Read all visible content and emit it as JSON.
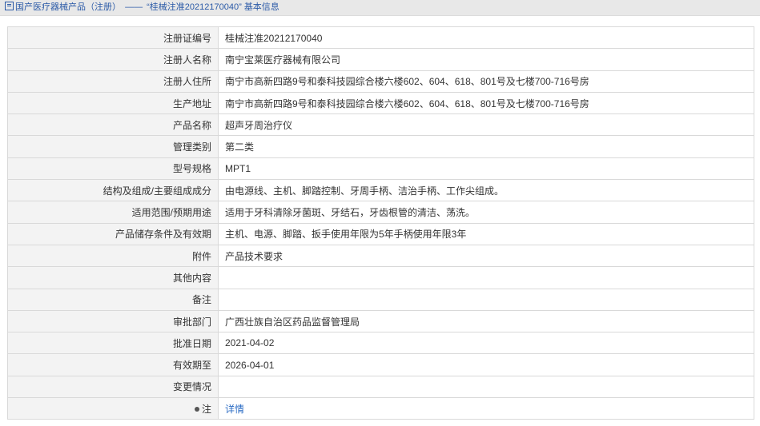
{
  "breadcrumb": {
    "part1": "国产医疗器械产品（注册）",
    "separator": "——",
    "part2": "“桂械注准20212170040”",
    "part3": "基本信息"
  },
  "rows": [
    {
      "label": "注册证编号",
      "value": "桂械注准20212170040"
    },
    {
      "label": "注册人名称",
      "value": "南宁宝莱医疗器械有限公司"
    },
    {
      "label": "注册人住所",
      "value": "南宁市高新四路9号和泰科技园综合楼六楼602、604、618、801号及七楼700-716号房"
    },
    {
      "label": "生产地址",
      "value": "南宁市高新四路9号和泰科技园综合楼六楼602、604、618、801号及七楼700-716号房"
    },
    {
      "label": "产品名称",
      "value": "超声牙周治疗仪"
    },
    {
      "label": "管理类别",
      "value": "第二类"
    },
    {
      "label": "型号规格",
      "value": "MPT1"
    },
    {
      "label": "结构及组成/主要组成成分",
      "value": "由电源线、主机、脚踏控制、牙周手柄、洁治手柄、工作尖组成。"
    },
    {
      "label": "适用范围/预期用途",
      "value": "适用于牙科清除牙菌斑、牙结石，牙齿根管的清洁、荡洗。"
    },
    {
      "label": "产品储存条件及有效期",
      "value": "主机、电源、脚踏、扳手使用年限为5年手柄使用年限3年"
    },
    {
      "label": "附件",
      "value": "产品技术要求"
    },
    {
      "label": "其他内容",
      "value": ""
    },
    {
      "label": "备注",
      "value": ""
    },
    {
      "label": "审批部门",
      "value": "广西壮族自治区药品监督管理局"
    },
    {
      "label": "批准日期",
      "value": "2021-04-02"
    },
    {
      "label": "有效期至",
      "value": "2026-04-01"
    },
    {
      "label": "变更情况",
      "value": ""
    },
    {
      "label": "注",
      "value": "详情"
    }
  ]
}
